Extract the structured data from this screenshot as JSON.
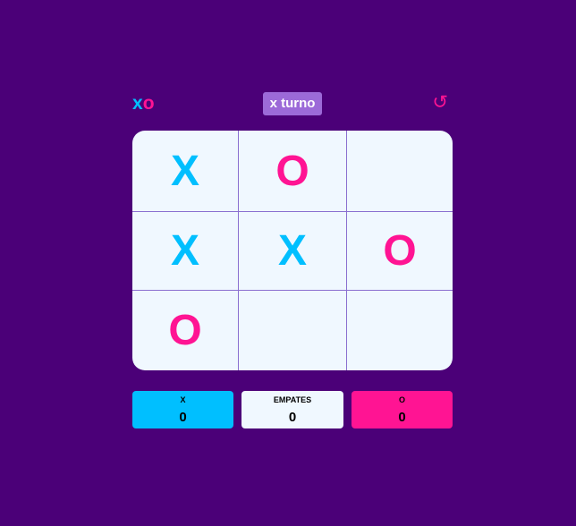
{
  "header": {
    "logo_x": "x",
    "logo_o": "o",
    "turn_label": "x turno",
    "reset_symbol": "↺"
  },
  "board": {
    "cells": [
      "X",
      "O",
      "",
      "X",
      "X",
      "O",
      "O",
      "",
      ""
    ]
  },
  "scores": {
    "x": {
      "label": "X",
      "value": "0"
    },
    "ties": {
      "label": "EMPATES",
      "value": "0"
    },
    "o": {
      "label": "O",
      "value": "0"
    }
  },
  "colors": {
    "background": "#4b0078",
    "x_color": "#00bfff",
    "o_color": "#ff1493",
    "board_bg": "#f0f8ff",
    "turn_bg": "#9c6ad8"
  }
}
